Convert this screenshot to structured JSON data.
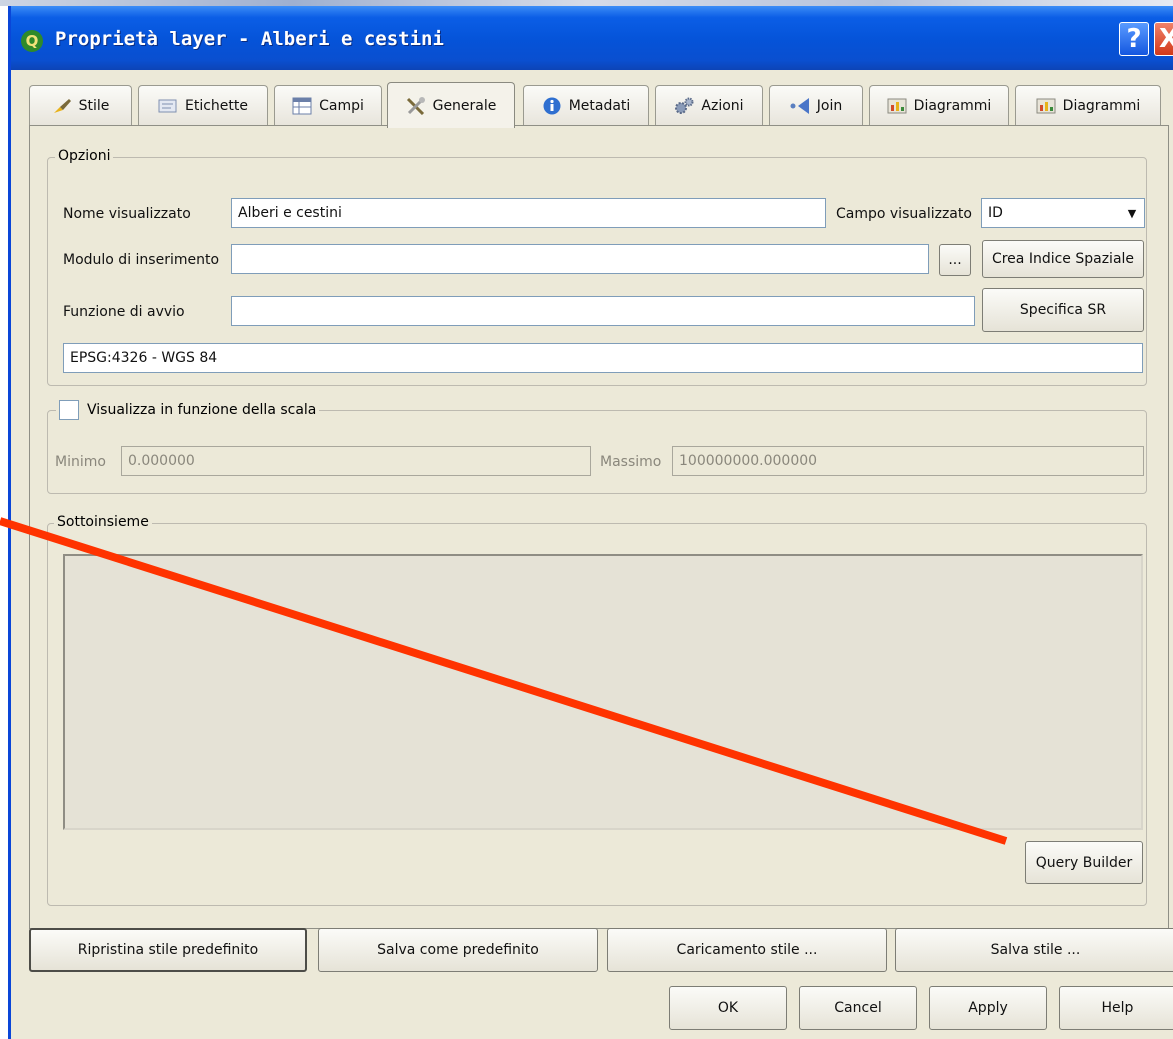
{
  "window": {
    "title": "Proprietà layer - Alberi e cestini",
    "logo_letter": "Q",
    "help_label": "?",
    "close_label": "X"
  },
  "tabs": [
    {
      "label": "Stile",
      "icon": "paintbrush-icon"
    },
    {
      "label": "Etichette",
      "icon": "label-icon"
    },
    {
      "label": "Campi",
      "icon": "table-icon"
    },
    {
      "label": "Generale",
      "icon": "tools-icon",
      "active": true
    },
    {
      "label": "Metadati",
      "icon": "info-icon"
    },
    {
      "label": "Azioni",
      "icon": "gears-icon"
    },
    {
      "label": "Join",
      "icon": "join-icon"
    },
    {
      "label": "Diagrammi",
      "icon": "diagram-icon"
    },
    {
      "label": "Diagrammi",
      "icon": "diagram-icon"
    }
  ],
  "opzioni": {
    "title": "Opzioni",
    "nome_label": "Nome visualizzato",
    "nome_value": "Alberi e cestini",
    "campo_label": "Campo visualizzato",
    "campo_value": "ID",
    "modulo_label": "Modulo di inserimento",
    "modulo_value": "",
    "browse_label": "...",
    "crea_indice_label": "Crea Indice Spaziale",
    "funzione_label": "Funzione di avvio",
    "funzione_value": "",
    "specifica_sr_label": "Specifica SR",
    "crs_value": "EPSG:4326 - WGS 84"
  },
  "scala": {
    "title": "Visualizza in funzione della scala",
    "checked": false,
    "minimo_label": "Minimo",
    "minimo_value": "0.000000",
    "massimo_label": "Massimo",
    "massimo_value": "100000000.000000"
  },
  "sottoinsieme": {
    "title": "Sottoinsieme",
    "query_text": "",
    "query_builder_label": "Query Builder"
  },
  "footer": {
    "ripristina_label": "Ripristina stile predefinito",
    "salva_predefinito_label": "Salva come predefinito",
    "caricamento_label": "Caricamento stile ...",
    "salva_stile_label": "Salva stile ...",
    "ok_label": "OK",
    "cancel_label": "Cancel",
    "apply_label": "Apply",
    "help_label": "Help"
  },
  "colors": {
    "titlebar": "#0553d8",
    "dialog_bg": "#ece9d8",
    "annotation_line": "#ff3300"
  }
}
